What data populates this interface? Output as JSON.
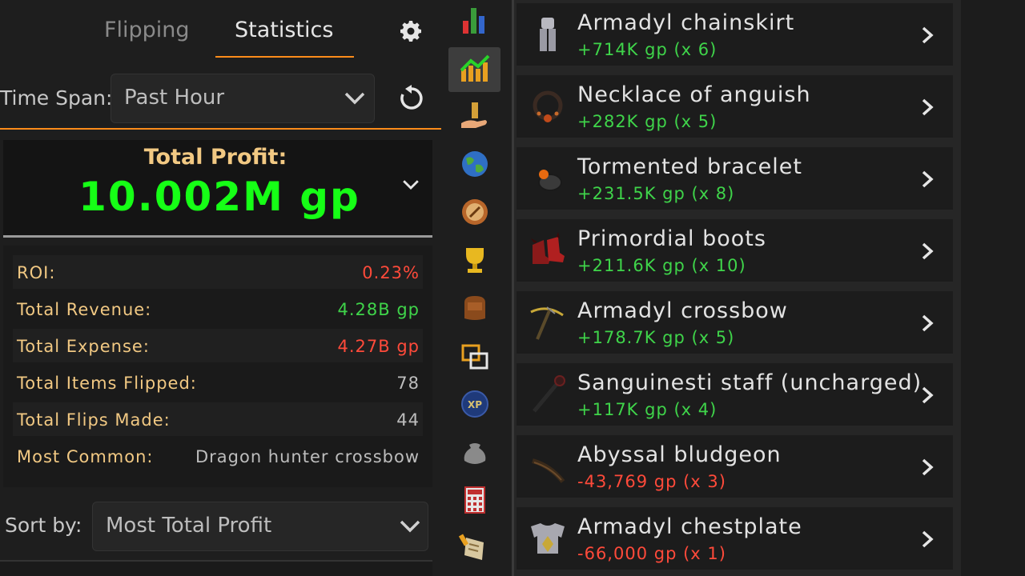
{
  "tabs": {
    "flipping": "Flipping",
    "statistics": "Statistics"
  },
  "time_span": {
    "label": "Time Span:",
    "value": "Past Hour"
  },
  "profit": {
    "label": "Total Profit:",
    "value": "10.002M gp"
  },
  "stats": [
    {
      "label": "ROI:",
      "value": "0.23%",
      "color": "#ff4a3a"
    },
    {
      "label": "Total Revenue:",
      "value": "4.28B gp",
      "color": "#3fd44a"
    },
    {
      "label": "Total Expense:",
      "value": "4.27B gp",
      "color": "#ff4a3a"
    },
    {
      "label": "Total Items Flipped:",
      "value": "78",
      "color": "#bdbdbd"
    },
    {
      "label": "Total Flips Made:",
      "value": "44",
      "color": "#bdbdbd"
    },
    {
      "label": "Most Common:",
      "value": "Dragon hunter crossbow",
      "color": "#bdbdbd"
    }
  ],
  "sort_by": {
    "label": "Sort by:",
    "value": "Most Total Profit"
  },
  "nav_icons": [
    "bar-chart-icon",
    "line-chart-icon",
    "hand-coin-icon",
    "globe-icon",
    "compass-icon",
    "trophy-icon",
    "bag-icon",
    "window-icon",
    "xp-icon",
    "coin-pouch-icon",
    "calculator-icon",
    "scroll-icon"
  ],
  "items": [
    {
      "name": "Armadyl chainskirt",
      "profit": "+714K gp (x 6)",
      "positive": true,
      "icon": "chainskirt-icon"
    },
    {
      "name": "Necklace of anguish",
      "profit": "+282K gp (x 5)",
      "positive": true,
      "icon": "necklace-icon"
    },
    {
      "name": "Tormented bracelet",
      "profit": "+231.5K gp (x 8)",
      "positive": true,
      "icon": "bracelet-icon"
    },
    {
      "name": "Primordial boots",
      "profit": "+211.6K gp (x 10)",
      "positive": true,
      "icon": "boots-icon"
    },
    {
      "name": "Armadyl crossbow",
      "profit": "+178.7K gp (x 5)",
      "positive": true,
      "icon": "crossbow-icon"
    },
    {
      "name": "Sanguinesti staff (uncharged)",
      "profit": "+117K gp (x 4)",
      "positive": true,
      "icon": "staff-icon"
    },
    {
      "name": "Abyssal bludgeon",
      "profit": "-43,769 gp (x 3)",
      "positive": false,
      "icon": "bludgeon-icon"
    },
    {
      "name": "Armadyl chestplate",
      "profit": "-66,000 gp (x 1)",
      "positive": false,
      "icon": "chestplate-icon"
    }
  ],
  "colors": {
    "accent": "#ff8c1a",
    "profit_green": "#16ff16",
    "positive": "#3fd44a",
    "negative": "#ff4a3a",
    "label_gold": "#f2c983"
  }
}
